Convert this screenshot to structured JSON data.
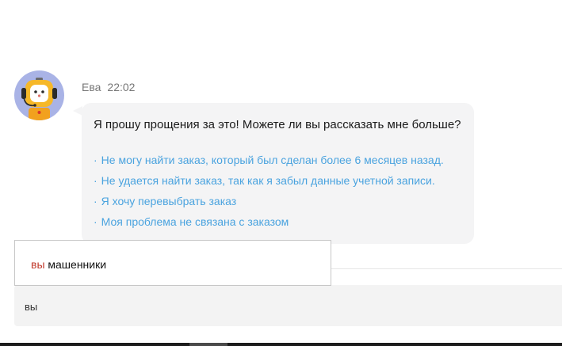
{
  "message": {
    "sender_name": "Ева",
    "time": "22:02",
    "avatar_icon": "robot-assistant-avatar-icon",
    "question": "Я прошу прощения за это! Можете ли вы рассказать мне больше?",
    "bullet": "·",
    "options": [
      {
        "label": "Не могу найти заказ, который был сделан более 6 месяцев назад."
      },
      {
        "label": "Не удается найти заказ, так как я забыл данные учетной записи."
      },
      {
        "label": "Я хочу перевыбрать заказ"
      },
      {
        "label": "Моя проблема не связана с заказом"
      }
    ]
  },
  "autocomplete": {
    "match": "вы",
    "rest": " машенники"
  },
  "composer": {
    "value": "вы"
  },
  "colors": {
    "link": "#4aa3df",
    "bubble": "#f4f4f5",
    "avatar_bg": "#a9b3e6",
    "match_highlight": "#c0392b"
  }
}
